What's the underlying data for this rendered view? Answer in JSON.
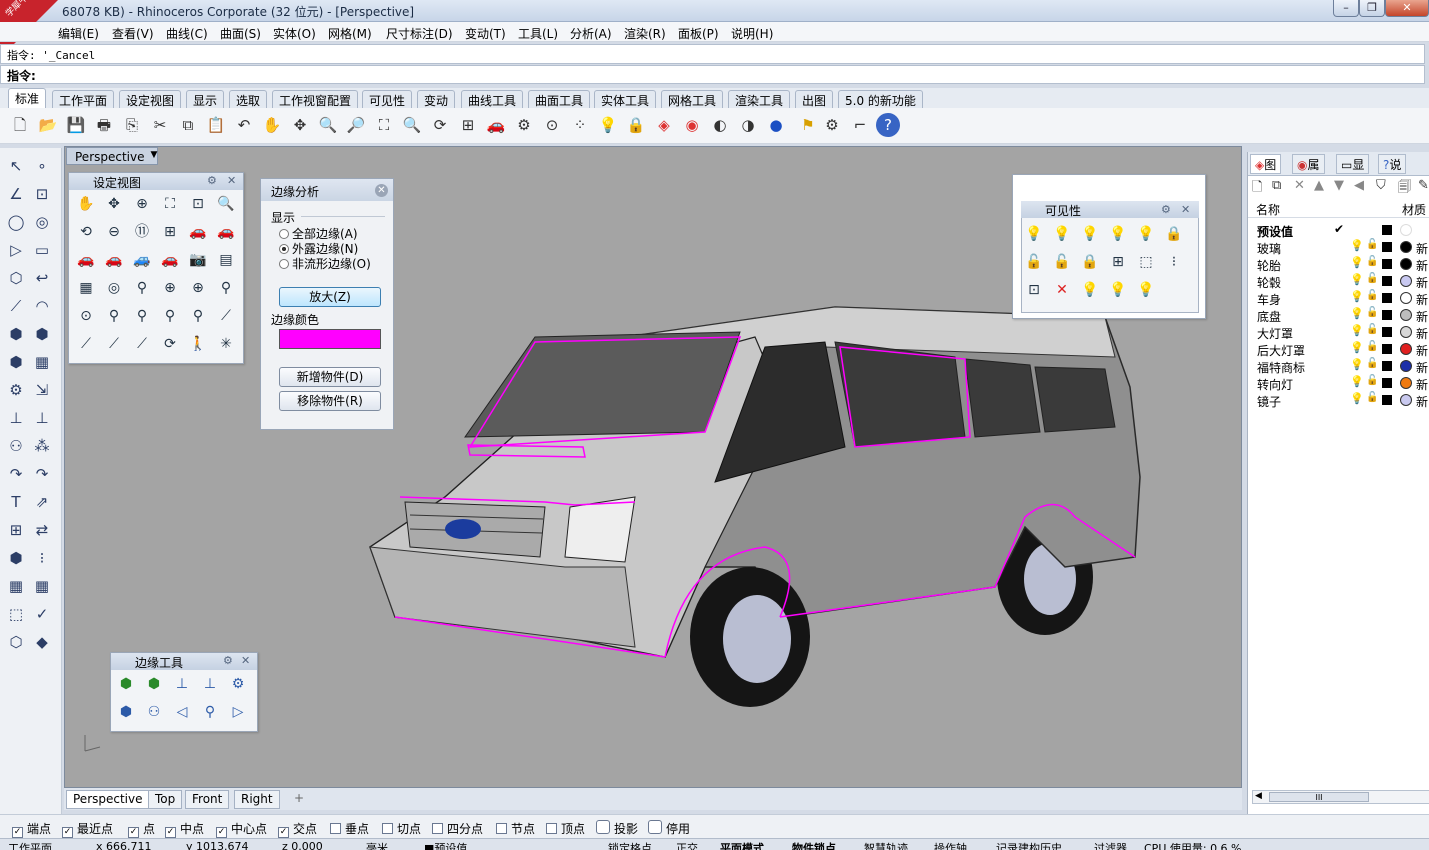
{
  "window": {
    "title": "68078 KB) - Rhinoceros Corporate (32 位元) - [Perspective]",
    "logo_text": "学犀牛中文网",
    "logo_url": "xuexiniu"
  },
  "menu": [
    "编辑(E)",
    "查看(V)",
    "曲线(C)",
    "曲面(S)",
    "实体(O)",
    "网格(M)",
    "尺寸标注(D)",
    "变动(T)",
    "工具(L)",
    "分析(A)",
    "渲染(R)",
    "面板(P)",
    "说明(H)"
  ],
  "command": {
    "history_prefix": "指令: ",
    "history": "'_Cancel",
    "prompt": "指令:"
  },
  "tabs": [
    "标准",
    "工作平面",
    "设定视图",
    "显示",
    "选取",
    "工作视窗配置",
    "可见性",
    "变动",
    "曲线工具",
    "曲面工具",
    "实体工具",
    "网格工具",
    "渲染工具",
    "出图",
    "5.0 的新功能"
  ],
  "viewport": {
    "label": "Perspective",
    "tabs": [
      "Perspective",
      "Top",
      "Front",
      "Right"
    ],
    "add_tab": "+"
  },
  "panels": {
    "setview": {
      "title": "设定视图"
    },
    "visibility": {
      "title": "可见性"
    },
    "edgetools": {
      "title": "边缘工具"
    }
  },
  "edge_analysis": {
    "title": "边缘分析",
    "display_label": "显示",
    "options": [
      "全部边缘(A)",
      "外露边缘(N)",
      "非流形边缘(O)"
    ],
    "selected": 1,
    "zoom_button": "放大(Z)",
    "color_label": "边缘颜色",
    "edge_color": "#ff00ff",
    "add_button": "新增物件(D)",
    "remove_button": "移除物件(R)"
  },
  "right_panel": {
    "tabs": [
      "图",
      "属",
      "显",
      "说"
    ],
    "col_name": "名称",
    "col_material": "材质",
    "layers": [
      {
        "name": "预设值",
        "current": true,
        "color": "#000000",
        "mat": "#ffffff",
        "mat_text": ""
      },
      {
        "name": "玻璃",
        "current": false,
        "color": "#000000",
        "mat": "#000000",
        "mat_text": "新"
      },
      {
        "name": "轮胎",
        "current": false,
        "color": "#000000",
        "mat": "#000000",
        "mat_text": "新"
      },
      {
        "name": "轮毂",
        "current": false,
        "color": "#000000",
        "mat": "#c8c8f0",
        "mat_text": "新"
      },
      {
        "name": "车身",
        "current": false,
        "color": "#000000",
        "mat": "#ffffff",
        "mat_text": "新"
      },
      {
        "name": "底盘",
        "current": false,
        "color": "#000000",
        "mat": "#bdbdbd",
        "mat_text": "新"
      },
      {
        "name": "大灯罩",
        "current": false,
        "color": "#000000",
        "mat": "#d8d8d8",
        "mat_text": "新"
      },
      {
        "name": "后大灯罩",
        "current": false,
        "color": "#000000",
        "mat": "#e02020",
        "mat_text": "新"
      },
      {
        "name": "福特商标",
        "current": false,
        "color": "#000000",
        "mat": "#1c2fa8",
        "mat_text": "新"
      },
      {
        "name": "转向灯",
        "current": false,
        "color": "#000000",
        "mat": "#f07a10",
        "mat_text": "新"
      },
      {
        "name": "镜子",
        "current": false,
        "color": "#000000",
        "mat": "#c9c9ef",
        "mat_text": "新"
      }
    ],
    "scroll_text": "III"
  },
  "osnap": [
    {
      "label": "端点",
      "checked": true
    },
    {
      "label": "最近点",
      "checked": true
    },
    {
      "label": "点",
      "checked": true
    },
    {
      "label": "中点",
      "checked": true
    },
    {
      "label": "中心点",
      "checked": true
    },
    {
      "label": "交点",
      "checked": true
    },
    {
      "label": "垂点",
      "checked": false
    },
    {
      "label": "切点",
      "checked": false
    },
    {
      "label": "四分点",
      "checked": false
    },
    {
      "label": "节点",
      "checked": false
    },
    {
      "label": "顶点",
      "checked": false
    },
    {
      "label": "投影",
      "checked": false
    },
    {
      "label": "停用",
      "checked": false
    }
  ],
  "status": [
    "工作平面",
    "x 666.711",
    "y 1013.674",
    "z 0.000",
    "毫米",
    "■预设值",
    "锁定格点",
    "正交",
    "平面模式",
    "物件锁点",
    "智慧轨迹",
    "操作轴",
    "记录建构历史",
    "过滤器",
    "CPU 使用量: 0.6 %"
  ]
}
